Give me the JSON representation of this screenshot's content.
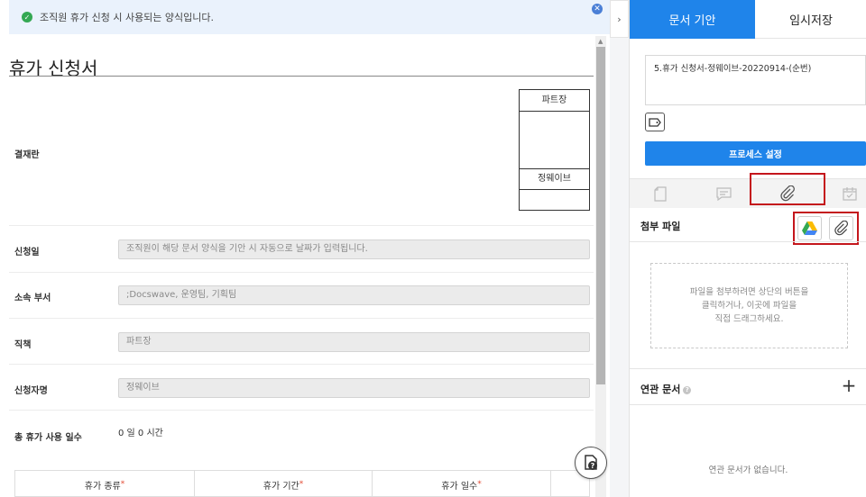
{
  "notice": {
    "text": "조직원 휴가 신청 시 사용되는 양식입니다."
  },
  "document": {
    "title": "휴가 신청서",
    "approval": {
      "label": "결재란",
      "role_header": "파트장",
      "approver_name": "정웨이브"
    },
    "fields": [
      {
        "label": "신청일",
        "value": "조직원이 해당 문서 양식을 기안 시 자동으로 날짜가 입력됩니다."
      },
      {
        "label": "소속 부서",
        "value": ";Docswave, 운영팀, 기획팀"
      },
      {
        "label": "직책",
        "value": "파트장"
      },
      {
        "label": "신청자명",
        "value": "정웨이브"
      }
    ],
    "total_days": {
      "label": "총 휴가 사용 일수",
      "value": "0 일 0 시간"
    },
    "vacation_table": {
      "headers": [
        "휴가 종류",
        "휴가 기간",
        "휴가 일수"
      ],
      "required_mark": "*"
    }
  },
  "right_panel": {
    "tabs": {
      "active": "문서 기안",
      "inactive": "임시저장"
    },
    "doc_name": "5.휴가 신청서-정웨이브-20220914-(순번)",
    "process_button": "프로세스 설정",
    "attachments": {
      "title": "첨부 파일",
      "drop_hint": [
        "파일을 첨부하려면 상단의 버튼을",
        "클릭하거나, 이곳에 파일을",
        "직접 드래그하세요."
      ]
    },
    "related": {
      "title": "연관 문서",
      "info_glyph": "?",
      "empty": "연관 문서가 없습니다."
    }
  },
  "colors": {
    "primary": "#1f84ea",
    "highlight": "#c4161c",
    "notice_bg": "#eaf2fc",
    "success": "#34a853"
  },
  "icons": {
    "notice": "check-circle-icon",
    "notice_close": "close-icon",
    "tag": "tag-icon",
    "tab_doc": "document-icon",
    "tab_comment": "comment-icon",
    "tab_attach": "paperclip-icon",
    "tab_calendar": "calendar-icon",
    "google_drive": "google-drive-icon",
    "attach": "paperclip-icon",
    "help": "help-icon"
  }
}
